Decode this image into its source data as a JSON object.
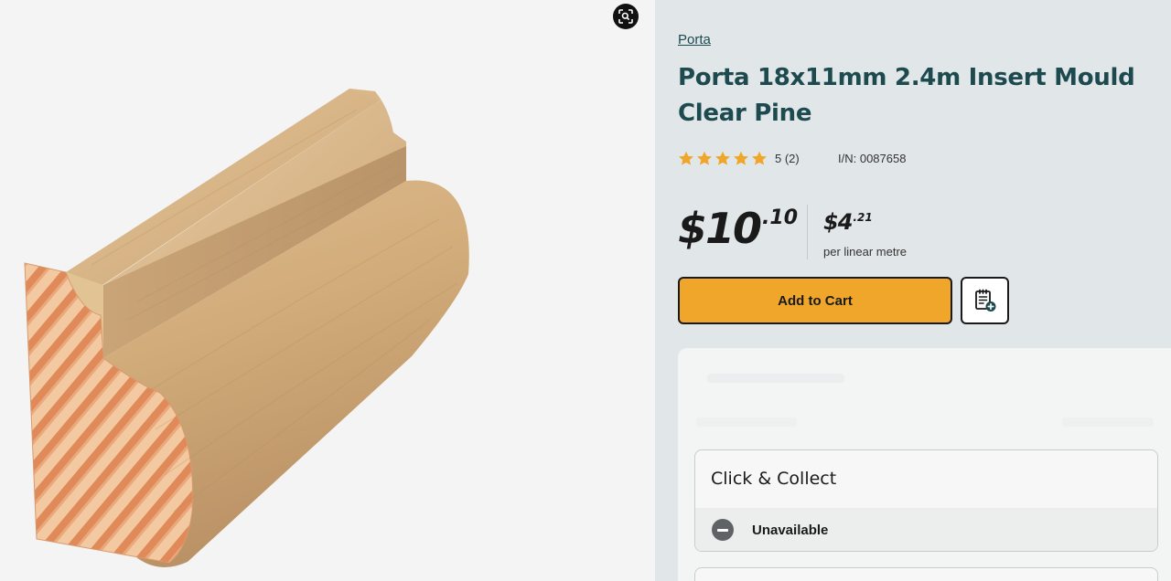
{
  "product": {
    "brand": "Porta",
    "title": "Porta 18x11mm 2.4m Insert Mould Clear Pine",
    "rating": 5,
    "rating_text": "5 (2)",
    "item_number": "I/N: 0087658"
  },
  "price": {
    "dollars": "$10",
    "cents": ".10",
    "unit_dollars": "$4",
    "unit_cents": ".21",
    "unit_label": "per linear metre"
  },
  "actions": {
    "add_to_cart": "Add to Cart",
    "add_to_list_icon": "clipboard-plus-icon",
    "zoom_icon": "zoom-search-icon"
  },
  "fulfilment": {
    "click_collect_title": "Click & Collect",
    "click_collect_status": "Unavailable",
    "status_icon": "minus-circle-icon"
  },
  "colors": {
    "heading": "#1d4a4f",
    "cart_button": "#f0a52b",
    "star": "#f0a52b",
    "panel_bg": "#e1e6e8"
  }
}
